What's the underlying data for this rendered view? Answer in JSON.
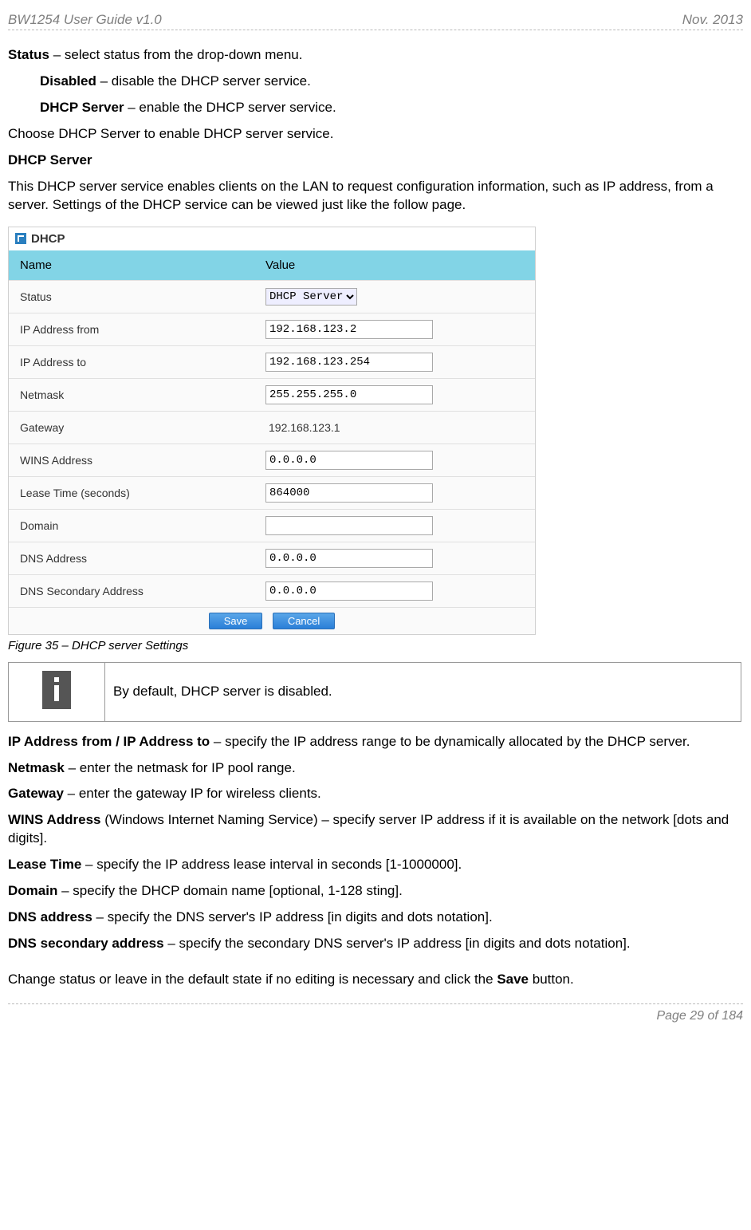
{
  "header": {
    "left": "BW1254 User Guide v1.0",
    "right": "Nov.  2013"
  },
  "intro": {
    "status_label": "Status",
    "status_desc": " – select status from the drop-down menu.",
    "disabled_label": "Disabled",
    "disabled_desc": " – disable the DHCP server service.",
    "dhcpserver_label": "DHCP Server",
    "dhcpserver_desc": " – enable the DHCP server service.",
    "choose_line": "Choose DHCP Server to enable DHCP server service.",
    "section_head": "DHCP Server",
    "para": "This DHCP server service enables clients on the LAN to request configuration information, such as IP address, from a server. Settings of the DHCP service can be viewed just like the follow page."
  },
  "dhcp": {
    "title": "DHCP",
    "col_name": "Name",
    "col_value": "Value",
    "rows": {
      "status": {
        "label": "Status",
        "value": "DHCP Server"
      },
      "ip_from": {
        "label": "IP Address from",
        "value": "192.168.123.2"
      },
      "ip_to": {
        "label": "IP Address to",
        "value": "192.168.123.254"
      },
      "netmask": {
        "label": "Netmask",
        "value": "255.255.255.0"
      },
      "gateway": {
        "label": "Gateway",
        "value": "192.168.123.1"
      },
      "wins": {
        "label": "WINS Address",
        "value": "0.0.0.0"
      },
      "lease": {
        "label": "Lease Time (seconds)",
        "value": "864000"
      },
      "domain": {
        "label": "Domain",
        "value": ""
      },
      "dns": {
        "label": "DNS Address",
        "value": "0.0.0.0"
      },
      "dns2": {
        "label": "DNS Secondary Address",
        "value": "0.0.0.0"
      }
    },
    "save": "Save",
    "cancel": "Cancel"
  },
  "figcap": "Figure 35 – DHCP server Settings",
  "infobox": "By default, DHCP server is disabled.",
  "defs": {
    "ipfrom_b": "IP Address from / IP Address to",
    "ipfrom_t": " – specify the IP address range to be dynamically allocated by the DHCP server.",
    "net_b": "Netmask",
    "net_t": " – enter the netmask for IP pool range.",
    "gw_b": "Gateway",
    "gw_t": " – enter the gateway IP for wireless clients.",
    "wins_b": "WINS Address",
    "wins_t1": " (Windows Internet Naming Service) – specify server IP address if it is available on the network [dots and digits].",
    "lease_b": "Lease Time",
    "lease_t": " – specify the IP address lease interval in seconds [1-1000000].",
    "dom_b": "Domain",
    "dom_t": " – specify the DHCP domain name [optional, 1-128 sting].",
    "dns_b": "DNS address",
    "dns_t": " – specify the DNS server's IP address [in digits and dots notation].",
    "dns2_b": "DNS secondary address",
    "dns2_t": " – specify the secondary DNS server's IP address [in digits and dots notation]."
  },
  "closing_pre": "Change status or leave in the default state if no editing is necessary and click the ",
  "closing_b": "Save",
  "closing_post": " button.",
  "footer": "Page 29 of 184"
}
